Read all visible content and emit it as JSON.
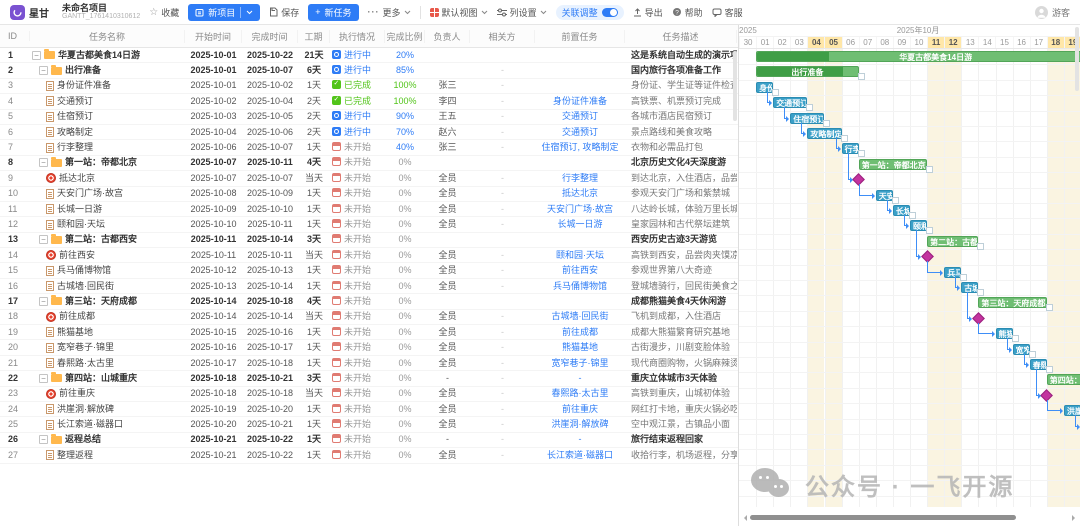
{
  "toolbar": {
    "brand": "星甘",
    "project_title": "未命名项目",
    "project_sub": "GANTT_1761410310612",
    "favorite": "收藏",
    "new_project": "新项目",
    "save": "保存",
    "new_task": "新任务",
    "more": "更多",
    "default_view": "默认视图",
    "column_settings": "列设置",
    "link_adjust": "关联调整",
    "export": "导出",
    "help": "帮助",
    "support": "客服",
    "user": "游客"
  },
  "colors": {
    "accent_blue": "#2E7CF6",
    "done_green": "#52C41A",
    "not_gray": "#999999",
    "group_bar": "#6FBE73",
    "group_bar_progress": "#3F9E46",
    "task_bar": "#3BA0C8",
    "milestone": "#C3339F",
    "weekend_header": "#FFE7A8",
    "weekend_body": "#FAF4E1"
  },
  "table": {
    "columns": [
      {
        "label": "ID",
        "w": 30
      },
      {
        "label": "任务名称",
        "w": 155
      },
      {
        "label": "开始时间",
        "w": 57
      },
      {
        "label": "完成时间",
        "w": 56
      },
      {
        "label": "工期",
        "w": 32
      },
      {
        "label": "执行情况",
        "w": 55
      },
      {
        "label": "完成比例",
        "w": 40
      },
      {
        "label": "负责人",
        "w": 45
      },
      {
        "label": "相关方",
        "w": 65
      },
      {
        "label": "前置任务",
        "w": 90
      },
      {
        "label": "任务描述",
        "w": 112
      }
    ],
    "rows": [
      {
        "id": 1,
        "level": 0,
        "kind": "group",
        "name": "华夏古都美食14日游",
        "start": "2025-10-01",
        "end": "2025-10-22",
        "dur": "21天",
        "st": "run",
        "status": "进行中",
        "pct": "20%",
        "owner": "",
        "stake": "",
        "pred": "",
        "desc": "这是系统自动生成的演示项目，可",
        "bar": {
          "s": 1,
          "e": 22,
          "p": 20
        }
      },
      {
        "id": 2,
        "level": 1,
        "kind": "group",
        "name": "出行准备",
        "start": "2025-10-01",
        "end": "2025-10-07",
        "dur": "6天",
        "st": "run",
        "status": "进行中",
        "pct": "85%",
        "owner": "",
        "stake": "-",
        "pred": "",
        "desc": "国内旅行各项准备工作",
        "bar": {
          "s": 1,
          "e": 7,
          "p": 85
        }
      },
      {
        "id": 3,
        "level": 2,
        "kind": "task",
        "name": "身份证件准备",
        "start": "2025-10-01",
        "end": "2025-10-02",
        "dur": "1天",
        "st": "done",
        "status": "已完成",
        "pct": "100%",
        "owner": "张三",
        "stake": "-",
        "pred": "",
        "desc": "身份证、学生证等证件检查",
        "bar": {
          "s": 1,
          "e": 2
        }
      },
      {
        "id": 4,
        "level": 2,
        "kind": "task",
        "name": "交通预订",
        "start": "2025-10-02",
        "end": "2025-10-04",
        "dur": "2天",
        "st": "done",
        "status": "已完成",
        "pct": "100%",
        "owner": "李四",
        "stake": "-",
        "pred": "身份证件准备",
        "desc": "高铁票、机票预订完成",
        "bar": {
          "s": 2,
          "e": 4
        }
      },
      {
        "id": 5,
        "level": 2,
        "kind": "task",
        "name": "住宿预订",
        "start": "2025-10-03",
        "end": "2025-10-05",
        "dur": "2天",
        "st": "run",
        "status": "进行中",
        "pct": "90%",
        "owner": "王五",
        "stake": "-",
        "pred": "交通预订",
        "desc": "各城市酒店民宿预订",
        "bar": {
          "s": 3,
          "e": 5
        }
      },
      {
        "id": 6,
        "level": 2,
        "kind": "task",
        "name": "攻略制定",
        "start": "2025-10-04",
        "end": "2025-10-06",
        "dur": "2天",
        "st": "run",
        "status": "进行中",
        "pct": "70%",
        "owner": "赵六",
        "stake": "-",
        "pred": "交通预订",
        "desc": "景点路线和美食攻略",
        "bar": {
          "s": 4,
          "e": 6
        }
      },
      {
        "id": 7,
        "level": 2,
        "kind": "task",
        "name": "行李整理",
        "start": "2025-10-06",
        "end": "2025-10-07",
        "dur": "1天",
        "st": "not",
        "status": "未开始",
        "pct": "40%",
        "owner": "张三",
        "stake": "-",
        "pred": "住宿预订, 攻略制定",
        "desc": "衣物和必需品打包",
        "bar": {
          "s": 6,
          "e": 7
        }
      },
      {
        "id": 8,
        "level": 1,
        "kind": "group",
        "name": "第一站：帝都北京",
        "start": "2025-10-07",
        "end": "2025-10-11",
        "dur": "4天",
        "st": "not",
        "status": "未开始",
        "pct": "0%",
        "owner": "",
        "stake": "",
        "pred": "",
        "desc": "北京历史文化4天深度游",
        "bar": {
          "s": 7,
          "e": 11,
          "p": 0
        }
      },
      {
        "id": 9,
        "level": 2,
        "kind": "mile",
        "name": "抵达北京",
        "start": "2025-10-07",
        "end": "2025-10-07",
        "dur": "当天",
        "st": "not",
        "status": "未开始",
        "pct": "0%",
        "owner": "全员",
        "stake": "-",
        "pred": "行李整理",
        "desc": "到达北京，入住酒店，品尝北京烤",
        "bar": {
          "s": 7,
          "m": true
        }
      },
      {
        "id": 10,
        "level": 2,
        "kind": "task",
        "name": "天安门广场·故宫",
        "start": "2025-10-08",
        "end": "2025-10-09",
        "dur": "1天",
        "st": "not",
        "status": "未开始",
        "pct": "0%",
        "owner": "全员",
        "stake": "-",
        "pred": "抵达北京",
        "desc": "参观天安门广场和紫禁城",
        "bar": {
          "s": 8,
          "e": 9
        }
      },
      {
        "id": 11,
        "level": 2,
        "kind": "task",
        "name": "长城一日游",
        "start": "2025-10-09",
        "end": "2025-10-10",
        "dur": "1天",
        "st": "not",
        "status": "未开始",
        "pct": "0%",
        "owner": "全员",
        "stake": "-",
        "pred": "天安门广场·故宫",
        "desc": "八达岭长城，体验万里长城雄伟",
        "bar": {
          "s": 9,
          "e": 10
        }
      },
      {
        "id": 12,
        "level": 2,
        "kind": "task",
        "name": "颐和园·天坛",
        "start": "2025-10-10",
        "end": "2025-10-11",
        "dur": "1天",
        "st": "not",
        "status": "未开始",
        "pct": "0%",
        "owner": "全员",
        "stake": "-",
        "pred": "长城一日游",
        "desc": "皇家园林和古代祭坛建筑",
        "bar": {
          "s": 10,
          "e": 11
        }
      },
      {
        "id": 13,
        "level": 1,
        "kind": "group",
        "name": "第二站：古都西安",
        "start": "2025-10-11",
        "end": "2025-10-14",
        "dur": "3天",
        "st": "not",
        "status": "未开始",
        "pct": "0%",
        "owner": "",
        "stake": "",
        "pred": "",
        "desc": "西安历史古迹3天游览",
        "bar": {
          "s": 11,
          "e": 14,
          "p": 0
        }
      },
      {
        "id": 14,
        "level": 2,
        "kind": "mile",
        "name": "前往西安",
        "start": "2025-10-11",
        "end": "2025-10-11",
        "dur": "当天",
        "st": "not",
        "status": "未开始",
        "pct": "0%",
        "owner": "全员",
        "stake": "-",
        "pred": "颐和园·天坛",
        "desc": "高铁到西安，品尝肉夹馍凉皮",
        "bar": {
          "s": 11,
          "m": true
        }
      },
      {
        "id": 15,
        "level": 2,
        "kind": "task",
        "name": "兵马俑博物馆",
        "start": "2025-10-12",
        "end": "2025-10-13",
        "dur": "1天",
        "st": "not",
        "status": "未开始",
        "pct": "0%",
        "owner": "全员",
        "stake": "-",
        "pred": "前往西安",
        "desc": "参观世界第八大奇迹",
        "bar": {
          "s": 12,
          "e": 13
        }
      },
      {
        "id": 16,
        "level": 2,
        "kind": "task",
        "name": "古城墙·回民街",
        "start": "2025-10-13",
        "end": "2025-10-14",
        "dur": "1天",
        "st": "not",
        "status": "未开始",
        "pct": "0%",
        "owner": "全员",
        "stake": "-",
        "pred": "兵马俑博物馆",
        "desc": "登城墙骑行，回民街美食之旅",
        "bar": {
          "s": 13,
          "e": 14
        }
      },
      {
        "id": 17,
        "level": 1,
        "kind": "group",
        "name": "第三站：天府成都",
        "start": "2025-10-14",
        "end": "2025-10-18",
        "dur": "4天",
        "st": "not",
        "status": "未开始",
        "pct": "0%",
        "owner": "",
        "stake": "",
        "pred": "",
        "desc": "成都熊猫美食4天休闲游",
        "bar": {
          "s": 14,
          "e": 18,
          "p": 0
        }
      },
      {
        "id": 18,
        "level": 2,
        "kind": "mile",
        "name": "前往成都",
        "start": "2025-10-14",
        "end": "2025-10-14",
        "dur": "当天",
        "st": "not",
        "status": "未开始",
        "pct": "0%",
        "owner": "全员",
        "stake": "-",
        "pred": "古城墙·回民街",
        "desc": "飞机到成都，入住酒店",
        "bar": {
          "s": 14,
          "m": true
        }
      },
      {
        "id": 19,
        "level": 2,
        "kind": "task",
        "name": "熊猫基地",
        "start": "2025-10-15",
        "end": "2025-10-16",
        "dur": "1天",
        "st": "not",
        "status": "未开始",
        "pct": "0%",
        "owner": "全员",
        "stake": "-",
        "pred": "前往成都",
        "desc": "成都大熊猫繁育研究基地",
        "bar": {
          "s": 15,
          "e": 16
        }
      },
      {
        "id": 20,
        "level": 2,
        "kind": "task",
        "name": "宽窄巷子·锦里",
        "start": "2025-10-16",
        "end": "2025-10-17",
        "dur": "1天",
        "st": "not",
        "status": "未开始",
        "pct": "0%",
        "owner": "全员",
        "stake": "-",
        "pred": "熊猫基地",
        "desc": "古街漫步，川剧变脸体验",
        "bar": {
          "s": 16,
          "e": 17
        }
      },
      {
        "id": 21,
        "level": 2,
        "kind": "task",
        "name": "春熙路·太古里",
        "start": "2025-10-17",
        "end": "2025-10-18",
        "dur": "1天",
        "st": "not",
        "status": "未开始",
        "pct": "0%",
        "owner": "全员",
        "stake": "-",
        "pred": "宽窄巷子·锦里",
        "desc": "现代商圈购物，火锅麻辣烫",
        "bar": {
          "s": 17,
          "e": 18
        }
      },
      {
        "id": 22,
        "level": 1,
        "kind": "group",
        "name": "第四站：山城重庆",
        "start": "2025-10-18",
        "end": "2025-10-21",
        "dur": "3天",
        "st": "not",
        "status": "未开始",
        "pct": "0%",
        "owner": "-",
        "stake": "-",
        "pred": "-",
        "desc": "重庆立体城市3天体验",
        "bar": {
          "s": 18,
          "e": 21,
          "p": 0
        }
      },
      {
        "id": 23,
        "level": 2,
        "kind": "mile",
        "name": "前往重庆",
        "start": "2025-10-18",
        "end": "2025-10-18",
        "dur": "当天",
        "st": "not",
        "status": "未开始",
        "pct": "0%",
        "owner": "全员",
        "stake": "-",
        "pred": "春熙路·太古里",
        "desc": "高铁到重庆，山城初体验",
        "bar": {
          "s": 18,
          "m": true
        }
      },
      {
        "id": 24,
        "level": 2,
        "kind": "task",
        "name": "洪崖洞·解放碑",
        "start": "2025-10-19",
        "end": "2025-10-20",
        "dur": "1天",
        "st": "not",
        "status": "未开始",
        "pct": "0%",
        "owner": "全员",
        "stake": "-",
        "pred": "前往重庆",
        "desc": "网红打卡地，重庆火锅必吃",
        "bar": {
          "s": 19,
          "e": 20
        }
      },
      {
        "id": 25,
        "level": 2,
        "kind": "task",
        "name": "长江索道·磁器口",
        "start": "2025-10-20",
        "end": "2025-10-21",
        "dur": "1天",
        "st": "not",
        "status": "未开始",
        "pct": "0%",
        "owner": "全员",
        "stake": "-",
        "pred": "洪崖洞·解放碑",
        "desc": "空中观江景，古镇品小面",
        "bar": {
          "s": 20,
          "e": 21
        }
      },
      {
        "id": 26,
        "level": 1,
        "kind": "group",
        "name": "返程总结",
        "start": "2025-10-21",
        "end": "2025-10-22",
        "dur": "1天",
        "st": "not",
        "status": "未开始",
        "pct": "0%",
        "owner": "-",
        "stake": "-",
        "pred": "-",
        "desc": "旅行结束返程回家",
        "bar": {
          "s": 21,
          "e": 22,
          "p": 0
        }
      },
      {
        "id": 27,
        "level": 2,
        "kind": "task",
        "name": "整理返程",
        "start": "2025-10-21",
        "end": "2025-10-22",
        "dur": "1天",
        "st": "not",
        "status": "未开始",
        "pct": "0%",
        "owner": "全员",
        "stake": "-",
        "pred": "长江索道·磁器口",
        "desc": "收拾行李，机场返程，分享旅行回",
        "bar": {
          "s": 21,
          "e": 22
        }
      }
    ]
  },
  "gantt": {
    "year_left": "2025",
    "month_label": "2025年10月",
    "days": [
      "30",
      "01",
      "02",
      "03",
      "04",
      "05",
      "06",
      "07",
      "08",
      "09",
      "10",
      "11",
      "12",
      "13",
      "14",
      "15",
      "16",
      "17",
      "18",
      "19"
    ],
    "weekend": [
      4,
      5,
      11,
      12,
      18,
      19
    ],
    "links": [
      [
        3,
        4
      ],
      [
        4,
        5
      ],
      [
        5,
        6
      ],
      [
        6,
        7
      ],
      [
        7,
        9
      ],
      [
        9,
        10
      ],
      [
        10,
        11
      ],
      [
        11,
        12
      ],
      [
        12,
        14
      ],
      [
        14,
        15
      ],
      [
        15,
        16
      ],
      [
        16,
        18
      ],
      [
        18,
        19
      ],
      [
        19,
        20
      ],
      [
        20,
        21
      ],
      [
        21,
        23
      ],
      [
        23,
        24
      ],
      [
        24,
        25
      ],
      [
        25,
        27
      ]
    ]
  },
  "watermark": {
    "text": "公众号 · 一飞开源"
  }
}
